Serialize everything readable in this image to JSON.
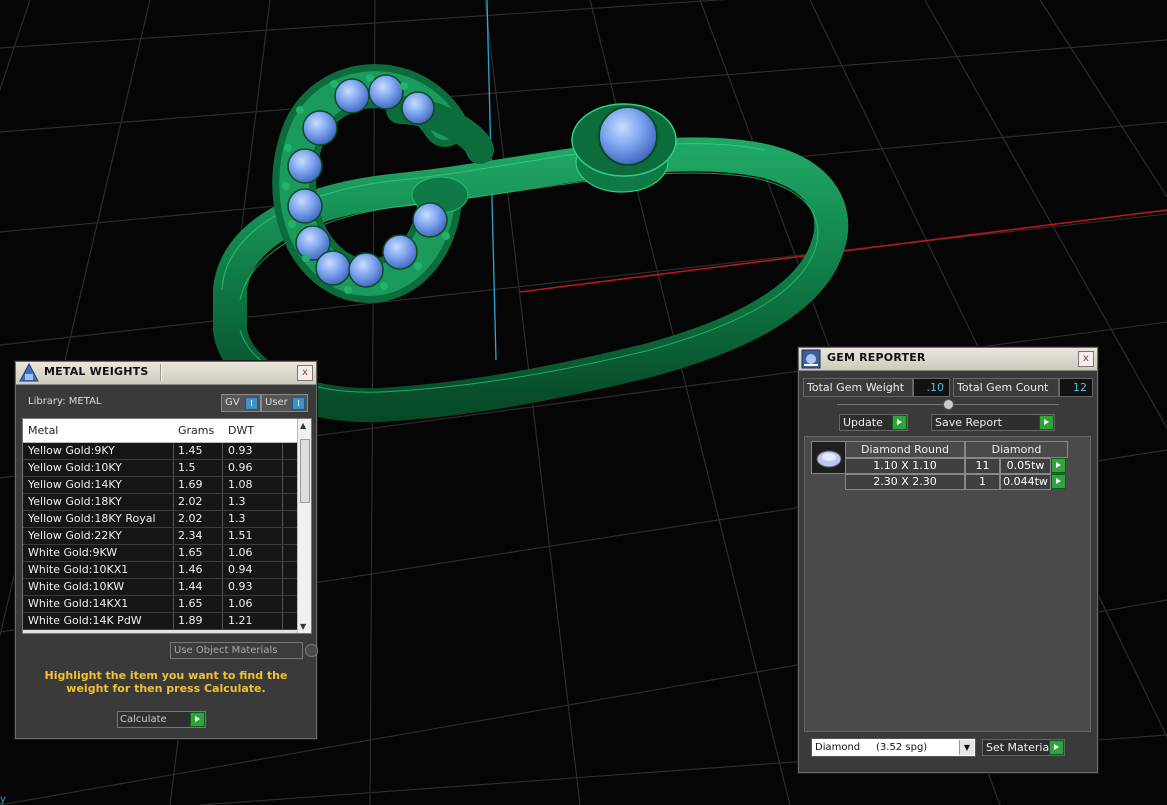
{
  "metal_weights": {
    "title": "METAL WEIGHTS",
    "close": "x",
    "library_label": "Library: METAL",
    "toggle_gv": "GV",
    "toggle_user": "User",
    "toggle_indicator": "I",
    "columns": [
      "Metal",
      "Grams",
      "DWT"
    ],
    "rows": [
      [
        "Yellow Gold:9KY",
        "1.45",
        "0.93"
      ],
      [
        "Yellow Gold:10KY",
        "1.5",
        "0.96"
      ],
      [
        "Yellow Gold:14KY",
        "1.69",
        "1.08"
      ],
      [
        "Yellow Gold:18KY",
        "2.02",
        "1.3"
      ],
      [
        "Yellow Gold:18KY Royal",
        "2.02",
        "1.3"
      ],
      [
        "Yellow Gold:22KY",
        "2.34",
        "1.51"
      ],
      [
        "White Gold:9KW",
        "1.65",
        "1.06"
      ],
      [
        "White Gold:10KX1",
        "1.46",
        "0.94"
      ],
      [
        "White Gold:10KW",
        "1.44",
        "0.93"
      ],
      [
        "White Gold:14KX1",
        "1.65",
        "1.06"
      ],
      [
        "White Gold:14K PdW",
        "1.89",
        "1.21"
      ]
    ],
    "use_object_materials": "Use Object Materials",
    "hint": "Highlight the item you want to find the weight for then press Calculate.",
    "calculate": "Calculate"
  },
  "gem_reporter": {
    "title": "GEM REPORTER",
    "close": "x",
    "total_weight_label": "Total Gem Weight",
    "total_weight_value": ".10",
    "total_count_label": "Total Gem Count",
    "total_count_value": "12",
    "update": "Update",
    "save_report": "Save Report",
    "gem_shape_header": "Diamond Round",
    "gem_material_header": "Diamond",
    "gems": [
      {
        "size": "1.10 X 1.10",
        "count": "11",
        "weight": "0.05tw"
      },
      {
        "size": "2.30 X 2.30",
        "count": "1",
        "weight": "0.044tw"
      }
    ],
    "material_select": "Diamond     (3.52 spg)",
    "set_material": "Set Material"
  },
  "colors": {
    "ring": "#0f7a45",
    "gem": "#5f8fe0",
    "accent_go": "#2ea43a",
    "value_text": "#4fc1e9",
    "hint_text": "#f1c232"
  }
}
